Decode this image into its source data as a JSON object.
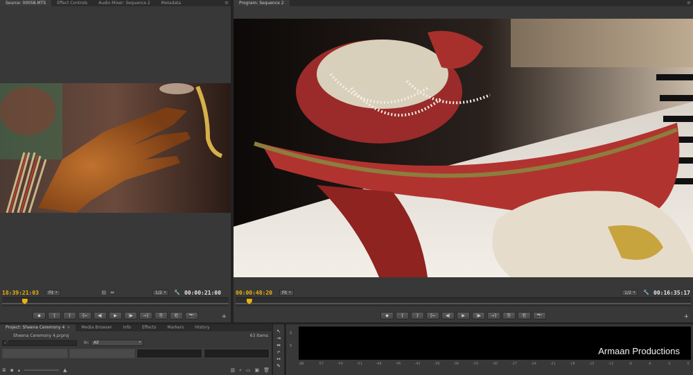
{
  "source_panel": {
    "tabs": [
      "Source: 00058.MTS",
      "Effect Controls",
      "Audio Mixer: Sequence 2",
      "Metadata"
    ],
    "timecode": "18:39:21:03",
    "fit": "Fit",
    "resolution": "1/2",
    "duration": "00:00:21:00",
    "playhead_fraction": 0.1,
    "controls": [
      "◆",
      "{",
      "}",
      "{←",
      "◀|",
      "▶",
      "|▶",
      "→}",
      "⎘",
      "⎗",
      "📷"
    ]
  },
  "program_panel": {
    "tabs": [
      "Program: Sequence 2"
    ],
    "timecode": "00:00:48:20",
    "fit": "Fit",
    "resolution": "1/2",
    "duration": "00:16:35:17",
    "playhead_fraction": 0.03,
    "controls": [
      "◆",
      "{",
      "}",
      "{←",
      "◀|",
      "▶",
      "|▶",
      "→}",
      "⎘",
      "⎗",
      "📷"
    ]
  },
  "project_panel": {
    "tabs": [
      "Project: Sheena Ceremony 4",
      "Media Browser",
      "Info",
      "Effects",
      "Markers",
      "History"
    ],
    "project_file": "Sheena Ceremony 4.prproj",
    "item_count": "63 Items",
    "in_label": "In:",
    "in_value": "All",
    "search_placeholder": "⌕˅"
  },
  "meters": {
    "ticks": [
      "dB",
      "-57",
      "-54",
      "-51",
      "-48",
      "-45",
      "-42",
      "-39",
      "-36",
      "-33",
      "-30",
      "-27",
      "-24",
      "-21",
      "-18",
      "-15",
      "-12",
      "-9",
      "-6",
      "-3",
      "0"
    ],
    "channel_labels": [
      "S",
      "S"
    ]
  },
  "watermark": "Armaan Productions",
  "colors": {
    "timecode_accent": "#e8b20e",
    "panel_bg": "#383838",
    "app_bg": "#232323"
  }
}
